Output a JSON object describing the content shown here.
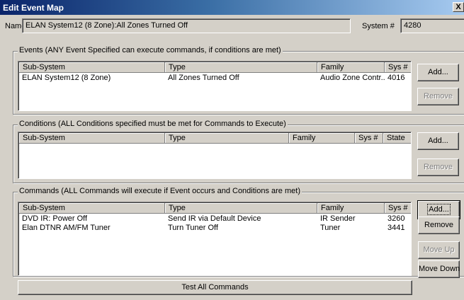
{
  "window": {
    "title": "Edit Event Map",
    "close_glyph": "X"
  },
  "header": {
    "name_label": "Name",
    "name_value": "ELAN System12 (8 Zone):All Zones Turned Off",
    "system_label": "System #",
    "system_value": "4280"
  },
  "events": {
    "title": "Events (ANY Event Specified can execute commands, if conditions are met)",
    "columns": [
      "Sub-System",
      "Type",
      "Family",
      "Sys #"
    ],
    "rows": [
      {
        "subsystem": "ELAN System12 (8 Zone)",
        "type": "All Zones Turned Off",
        "family": "Audio Zone Contr...",
        "sys": "4016"
      }
    ],
    "add_label": "Add...",
    "remove_label": "Remove"
  },
  "conditions": {
    "title": "Conditions (ALL Conditions specified must be met for Commands to Execute)",
    "columns": [
      "Sub-System",
      "Type",
      "Family",
      "Sys #",
      "State"
    ],
    "add_label": "Add...",
    "remove_label": "Remove"
  },
  "commands": {
    "title": "Commands (ALL Commands will execute if Event occurs and Conditions are met)",
    "columns": [
      "Sub-System",
      "Type",
      "Family",
      "Sys #"
    ],
    "rows": [
      {
        "subsystem": "DVD IR: Power Off",
        "type": "Send IR via Default Device",
        "family": "IR Sender",
        "sys": "3260"
      },
      {
        "subsystem": "Elan DTNR AM/FM Tuner",
        "type": "Turn Tuner Off",
        "family": "Tuner",
        "sys": "3441"
      }
    ],
    "add_label": "Add...",
    "remove_label": "Remove",
    "move_up_label": "Move Up",
    "move_down_label": "Move Down",
    "test_all_label": "Test All Commands"
  }
}
